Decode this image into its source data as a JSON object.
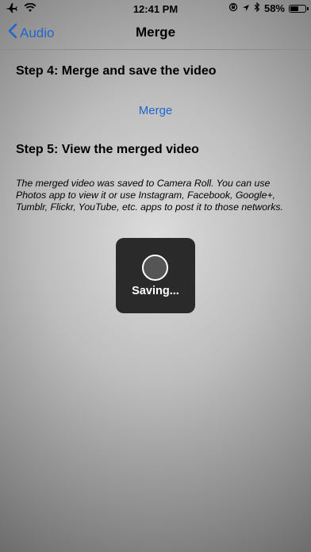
{
  "status_bar": {
    "time": "12:41 PM",
    "battery_percent": "58%",
    "battery_level": 0.58,
    "icons": [
      "airplane-icon",
      "wifi-icon",
      "orientation-lock-icon",
      "location-arrow-icon",
      "bluetooth-icon",
      "battery-icon"
    ]
  },
  "nav": {
    "back_label": "Audio",
    "title": "Merge"
  },
  "step4": {
    "heading": "Step 4: Merge and save the video",
    "action_label": "Merge"
  },
  "step5": {
    "heading": "Step 5: View the merged video",
    "description": "The merged video was saved to Camera Roll. You can use Photos app to view it or use Instagram, Facebook, Google+, Tumblr, Flickr, YouTube, etc. apps to post it to those networks."
  },
  "hud": {
    "label": "Saving..."
  },
  "colors": {
    "accent": "#1f66d0",
    "hud_background": "#2a2a2a"
  }
}
